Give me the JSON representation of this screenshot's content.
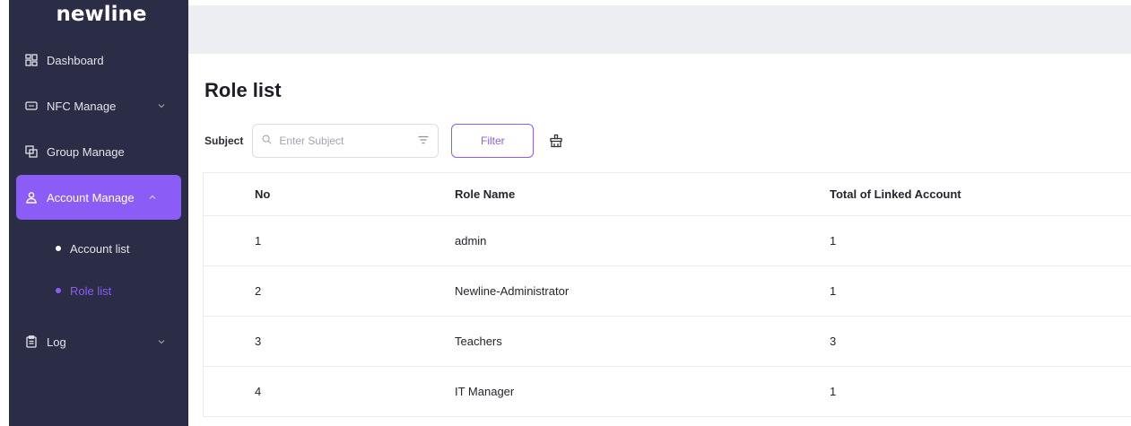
{
  "sidebar": {
    "brand": "newline",
    "items": [
      {
        "label": "Dashboard",
        "icon": "dashboard-icon"
      },
      {
        "label": "NFC Manage",
        "icon": "nfc-icon"
      },
      {
        "label": "Group Manage",
        "icon": "group-icon"
      },
      {
        "label": "Account Manage",
        "icon": "user-icon"
      },
      {
        "label": "Log",
        "icon": "clipboard-icon"
      }
    ],
    "sub_items": [
      {
        "label": "Account list"
      },
      {
        "label": "Role list"
      }
    ],
    "active_color": "#8b5cf6"
  },
  "main": {
    "title": "Role list",
    "filter": {
      "label": "Subject",
      "placeholder": "Enter Subject",
      "value": "",
      "button_label": "Filter"
    },
    "table": {
      "headers": [
        "No",
        "Role Name",
        "Total of Linked Account"
      ],
      "rows": [
        [
          "1",
          "admin",
          "1"
        ],
        [
          "2",
          "Newline-Administrator",
          "1"
        ],
        [
          "3",
          "Teachers",
          "3"
        ],
        [
          "4",
          "IT Manager",
          "1"
        ]
      ]
    }
  }
}
